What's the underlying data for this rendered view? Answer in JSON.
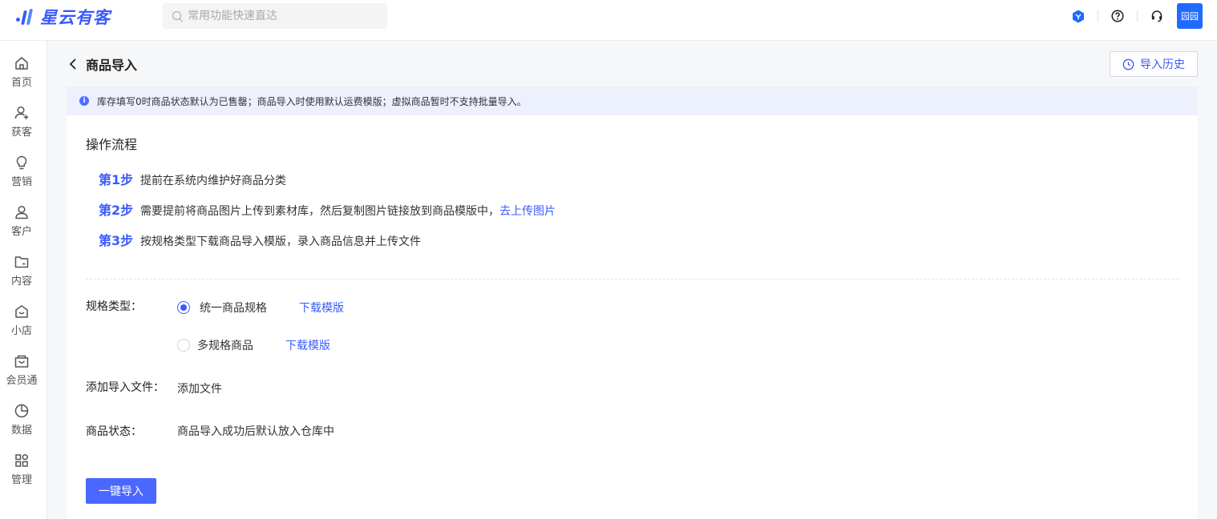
{
  "app": {
    "logo_text": "星云有客"
  },
  "search": {
    "placeholder": "常用功能快速直达"
  },
  "user": {
    "avatar_text": "园园"
  },
  "sidebar": {
    "items": [
      {
        "label": "首页",
        "icon": "home-icon"
      },
      {
        "label": "获客",
        "icon": "user-add-icon"
      },
      {
        "label": "营销",
        "icon": "bulb-icon"
      },
      {
        "label": "客户",
        "icon": "user-icon"
      },
      {
        "label": "内容",
        "icon": "folder-icon"
      },
      {
        "label": "小店",
        "icon": "shop-icon"
      },
      {
        "label": "会员通",
        "icon": "member-icon"
      },
      {
        "label": "数据",
        "icon": "pie-chart-icon"
      },
      {
        "label": "管理",
        "icon": "grid-icon"
      }
    ]
  },
  "header": {
    "title": "商品导入",
    "history_label": "导入历史"
  },
  "notice": {
    "text": "库存填写0时商品状态默认为已售罄；商品导入时使用默认运费模版；虚拟商品暂时不支持批量导入。"
  },
  "process": {
    "title": "操作流程",
    "steps": [
      {
        "num": "第1步",
        "text": "提前在系统内维护好商品分类",
        "link": ""
      },
      {
        "num": "第2步",
        "text": "需要提前将商品图片上传到素材库，然后复制图片链接放到商品模版中，",
        "link": "去上传图片"
      },
      {
        "num": "第3步",
        "text": "按规格类型下载商品导入模版，录入商品信息并上传文件",
        "link": ""
      }
    ]
  },
  "form": {
    "spec_label": "规格类型：",
    "spec_options": [
      {
        "label": "统一商品规格",
        "link": "下载模版",
        "checked": true
      },
      {
        "label": "多规格商品",
        "link": "下载模版",
        "checked": false
      }
    ],
    "file_label": "添加导入文件：",
    "file_link": "添加文件",
    "status_label": "商品状态：",
    "status_value": "商品导入成功后默认放入仓库中",
    "submit_label": "一键导入"
  }
}
